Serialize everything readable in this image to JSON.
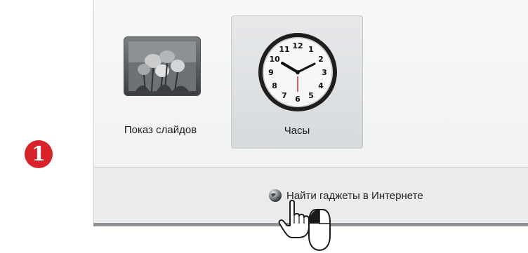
{
  "step_badge": {
    "number": "1",
    "color": "#d8232a"
  },
  "gadgets": [
    {
      "label": "Показ слайдов",
      "icon": "slideshow-icon",
      "selected": false
    },
    {
      "label": "Часы",
      "icon": "clock-icon",
      "selected": true
    }
  ],
  "clock": {
    "numbers": [
      "12",
      "1",
      "2",
      "3",
      "4",
      "5",
      "6",
      "7",
      "8",
      "9",
      "10",
      "11"
    ]
  },
  "footer": {
    "online_link_label": "Найти гаджеты в Интернете",
    "online_link_icon": "globe-icon"
  },
  "cursor": {
    "icon": "hand-pointer-icon",
    "mouse_icon": "mouse-left-click-icon"
  }
}
